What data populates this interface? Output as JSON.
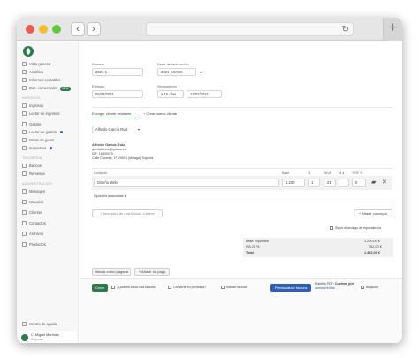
{
  "sidebar": {
    "items": [
      {
        "label": "Vista general"
      },
      {
        "label": "Analítica"
      },
      {
        "label": "Informes contables"
      },
      {
        "label": "Doc. comerciales",
        "badge": "NEW"
      }
    ],
    "section_ingresos": "INGRESOS",
    "ingresos": [
      {
        "label": "Ingresos"
      },
      {
        "label": "Lector de ingresos"
      }
    ],
    "gastos": [
      {
        "label": "Gastos"
      },
      {
        "label": "Lector de gastos"
      },
      {
        "label": "Notas de gasto"
      },
      {
        "label": "Impuestos"
      }
    ],
    "section_tesoreria": "TESORERÍA",
    "tesoreria": [
      {
        "label": "Bancos"
      },
      {
        "label": "Remesas"
      }
    ],
    "section_administracion": "ADMINISTRACIÓN",
    "administracion": [
      {
        "label": "Mensajes"
      },
      {
        "label": "Usuarios"
      },
      {
        "label": "Clientes"
      },
      {
        "label": "Contactos"
      },
      {
        "label": "Archivos"
      },
      {
        "label": "Productos"
      }
    ],
    "bottom": [
      {
        "label": "Centro de ayuda"
      },
      {
        "label": "Configuración"
      }
    ],
    "user": {
      "name": "C. Miguel Martínez",
      "company": "Empresa"
    }
  },
  "form": {
    "numero_label": "Número",
    "numero_value": "2021-1",
    "serie_label": "Serie de facturación",
    "serie_value": "2021-XXXXX",
    "emision_label": "Emisión",
    "emision_value": "05/02/2021",
    "venc_label": "Vencimiento",
    "venc_term": "a 15 días",
    "venc_value": "12/02/2021"
  },
  "client": {
    "tab_existing": "Escoger cliente existente",
    "tab_new": "Crear nuevo cliente",
    "selected": "Alfredo García Ruiz",
    "name": "Alfredo García Ruiz",
    "email": "garciaAfredo@yahoo.es",
    "nif": "NIF: 16800075",
    "address": "Calle Cáceres, 1ª, 29010 (Málaga), España"
  },
  "lines": {
    "headers": [
      "Concepto",
      "Base",
      "%",
      "%IVA",
      "% a",
      "%RF %"
    ],
    "concept": "Diseño Web",
    "base": "1.200",
    "qty": "1",
    "iva": "21",
    "rf": "0",
    "advanced": "Opciones avanzadas",
    "add_item": "Incorpora de una factura o bebel",
    "add_concept": "Añadir concepto",
    "equiv": "Sigue el recargo de equivalencia"
  },
  "totals": {
    "base_label": "Base imponible",
    "base_value": "1.200,00 €",
    "iva_label": "IVA 21 %",
    "iva_value": "252,00 €",
    "total_label": "Total",
    "total_value": "1.452,00 €"
  },
  "actions": {
    "mark_paid": "Marcar como pagada",
    "add_payment": "Añadir un pago",
    "create": "Crear",
    "opt_other": "¿Quieres crear otra factura?",
    "opt_periodic": "Convertir en periódica?",
    "opt_send": "Validar factura",
    "preview": "Previsualizar factura",
    "template_label": "Plantilla PDF:",
    "template_name": "Custom_plet",
    "template_change": "cambiar/editar",
    "block": "Bloquear"
  }
}
